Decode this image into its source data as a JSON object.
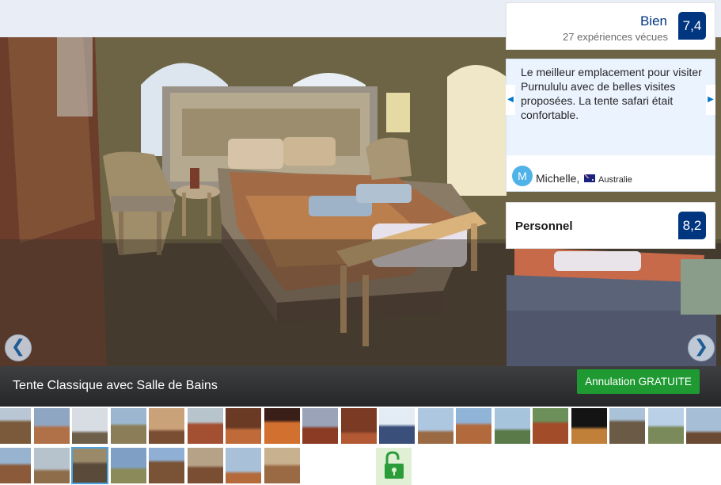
{
  "score": {
    "label": "Bien",
    "subtitle": "27 expériences vécues",
    "value": "7,4"
  },
  "review": {
    "text": "Le meilleur emplacement pour visiter Purnululu avec de belles visites proposées. La tente safari était confortable.",
    "avatar_letter": "M",
    "reviewer_name": "Michelle,",
    "country": "Australie",
    "prev_icon": "triangle-left-icon",
    "next_icon": "triangle-right-icon"
  },
  "staff": {
    "label": "Personnel",
    "value": "8,2"
  },
  "photo": {
    "caption": "Tente Classique avec Salle de Bains",
    "cancel_label": "Annulation GRATUITE",
    "prev_glyph": "❮",
    "next_glyph": "❯"
  },
  "thumbnails": {
    "count": 27,
    "selected_index": 21,
    "last_icon": "unlock-icon"
  },
  "colors": {
    "score_badge": "#003580",
    "review_background": "#ebf3ff",
    "cancel_button": "#1f9a32",
    "caption_bar": "#2f3032",
    "selected_thumb": "#4ca3e0"
  }
}
